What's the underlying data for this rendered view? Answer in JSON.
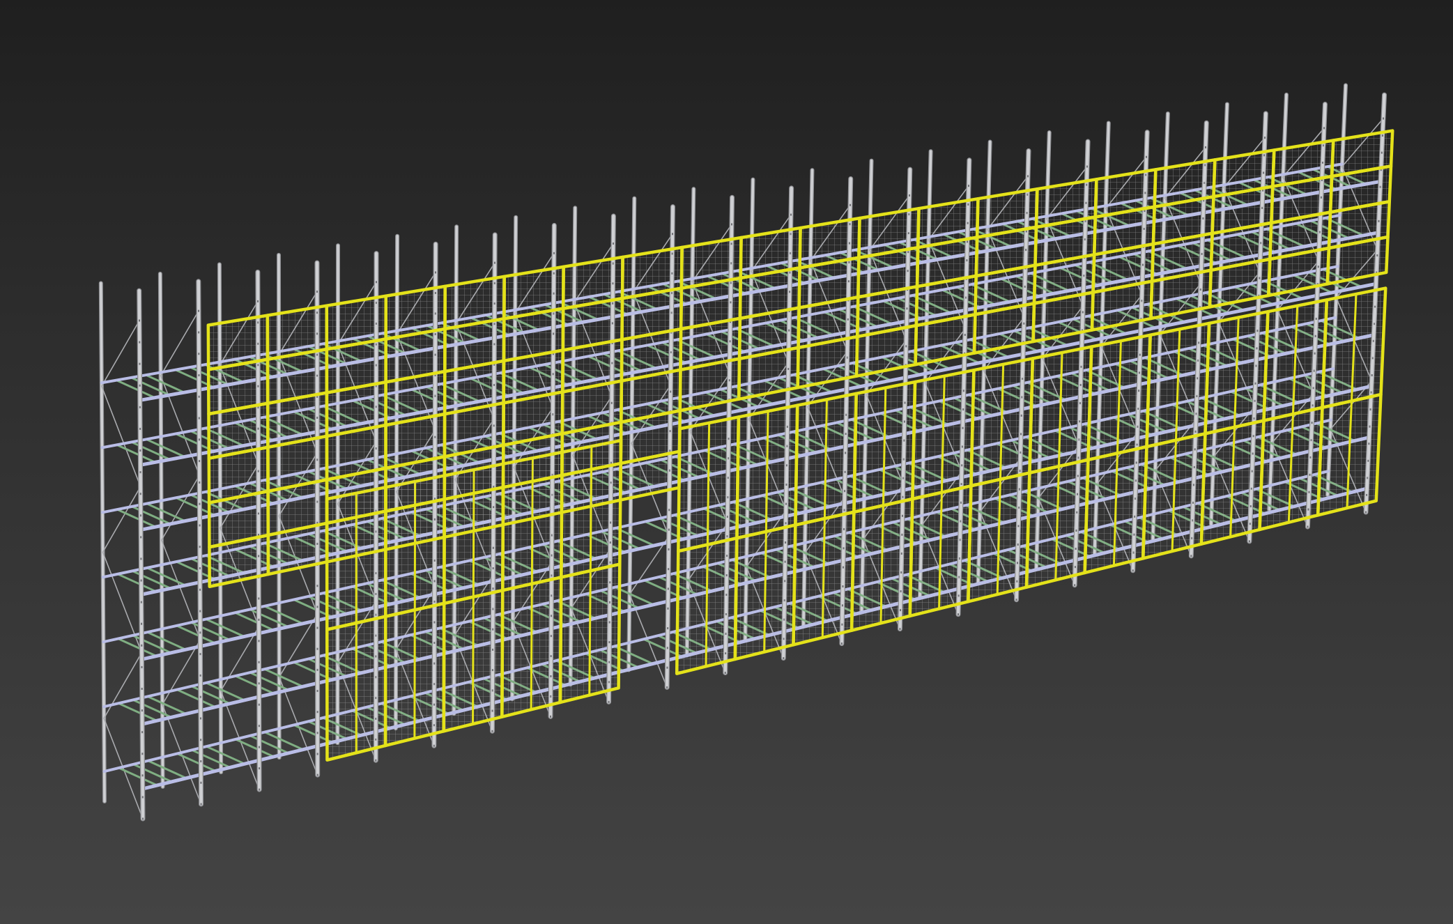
{
  "viewport": {
    "background_top": "#1f1f1f",
    "background_bottom": "#444444"
  },
  "model": {
    "upright_color": "#cfd0d3",
    "upright_shadow": "#8d8e92",
    "beam_color": "#b9bde6",
    "deck_color": "#7fae82",
    "panel_frame_color": "#e4e21a",
    "mesh_color": "#c9cacb"
  }
}
